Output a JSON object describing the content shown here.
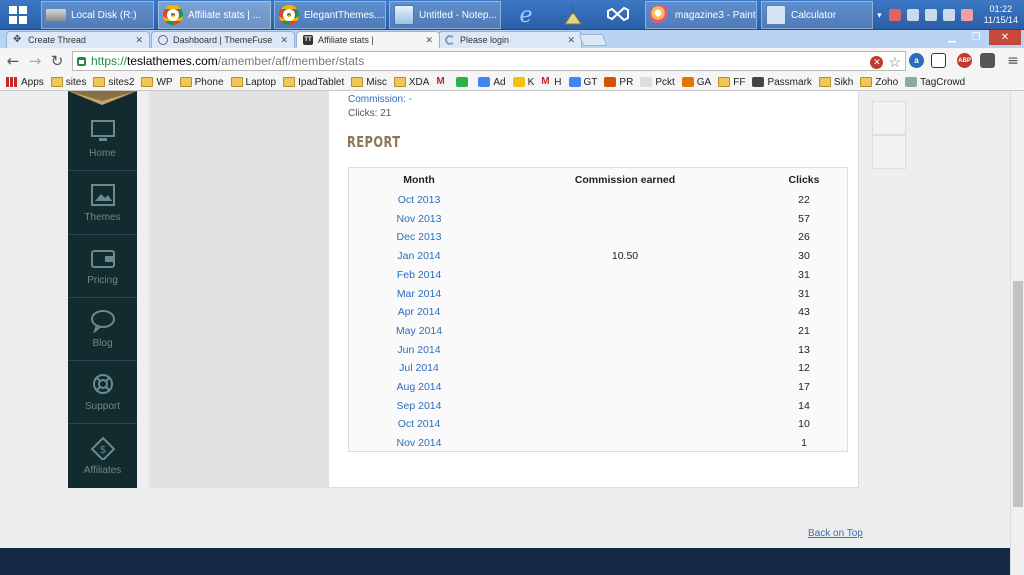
{
  "taskbar": {
    "items": [
      {
        "label": "Local Disk (R:)"
      },
      {
        "label": "Affiliate stats | ..."
      },
      {
        "label": "ElegantThemes...."
      },
      {
        "label": "Untitled - Notep..."
      },
      {
        "label": "magazine3 - Paint"
      },
      {
        "label": "Calculator"
      }
    ],
    "clock_time": "01:22",
    "clock_date": "11/15/14"
  },
  "browser": {
    "tabs": [
      {
        "label": "Create Thread"
      },
      {
        "label": "Dashboard | ThemeFuse"
      },
      {
        "label": "Affiliate stats |",
        "active": true
      },
      {
        "label": "Please login"
      }
    ],
    "url_scheme": "https://",
    "url_host": "teslathemes.com",
    "url_path": "/amember/aff/member/stats",
    "bookmarks": [
      {
        "label": "Apps",
        "icon": "apps-grid-icon"
      },
      {
        "label": "sites",
        "icon": "folder-icon"
      },
      {
        "label": "sites2",
        "icon": "folder-icon"
      },
      {
        "label": "WP",
        "icon": "folder-icon"
      },
      {
        "label": "Phone",
        "icon": "folder-icon"
      },
      {
        "label": "Laptop",
        "icon": "folder-icon"
      },
      {
        "label": "IpadTablet",
        "icon": "folder-icon"
      },
      {
        "label": "Misc",
        "icon": "folder-icon"
      },
      {
        "label": "XDA",
        "icon": "folder-icon"
      },
      {
        "label": "",
        "icon": "gmail-icon"
      },
      {
        "label": "",
        "icon": "feedly-icon"
      },
      {
        "label": "Ad",
        "icon": "google-icon"
      },
      {
        "label": "K",
        "icon": "k-icon"
      },
      {
        "label": "H",
        "icon": "gmail-icon"
      },
      {
        "label": "GT",
        "icon": "translate-icon"
      },
      {
        "label": "PR",
        "icon": "pr-icon"
      },
      {
        "label": "Pckt",
        "icon": "page-icon"
      },
      {
        "label": "GA",
        "icon": "analytics-icon"
      },
      {
        "label": "FF",
        "icon": "folder-icon"
      },
      {
        "label": "Passmark",
        "icon": "passmark-icon"
      },
      {
        "label": "Sikh",
        "icon": "folder-icon"
      },
      {
        "label": "Zoho",
        "icon": "folder-open-icon"
      },
      {
        "label": "TagCrowd",
        "icon": "tagcrowd-icon"
      }
    ]
  },
  "sidebar": {
    "items": [
      {
        "label": "Home",
        "icon": "monitor-icon"
      },
      {
        "label": "Themes",
        "icon": "image-icon"
      },
      {
        "label": "Pricing",
        "icon": "wallet-icon"
      },
      {
        "label": "Blog",
        "icon": "speech-bubble-icon"
      },
      {
        "label": "Support",
        "icon": "lifebuoy-icon"
      },
      {
        "label": "Affiliates",
        "icon": "dollar-tag-icon"
      }
    ]
  },
  "content": {
    "commission_line": "Commission: -",
    "clicks_line": "Clicks: 21",
    "report_title": "REPORT",
    "table": {
      "headers": [
        "Month",
        "Commission earned",
        "Clicks"
      ],
      "rows": [
        {
          "month": "Oct 2013",
          "commission": "",
          "clicks": "22"
        },
        {
          "month": "Nov 2013",
          "commission": "",
          "clicks": "57"
        },
        {
          "month": "Dec 2013",
          "commission": "",
          "clicks": "26"
        },
        {
          "month": "Jan 2014",
          "commission": "10.50",
          "clicks": "30"
        },
        {
          "month": "Feb 2014",
          "commission": "",
          "clicks": "31"
        },
        {
          "month": "Mar 2014",
          "commission": "",
          "clicks": "31"
        },
        {
          "month": "Apr 2014",
          "commission": "",
          "clicks": "43"
        },
        {
          "month": "May 2014",
          "commission": "",
          "clicks": "21"
        },
        {
          "month": "Jun 2014",
          "commission": "",
          "clicks": "13"
        },
        {
          "month": "Jul 2014",
          "commission": "",
          "clicks": "12"
        },
        {
          "month": "Aug 2014",
          "commission": "",
          "clicks": "17"
        },
        {
          "month": "Sep 2014",
          "commission": "",
          "clicks": "14"
        },
        {
          "month": "Oct 2014",
          "commission": "",
          "clicks": "10"
        },
        {
          "month": "Nov 2014",
          "commission": "",
          "clicks": "1"
        }
      ]
    },
    "back_on_top": "Back on Top"
  },
  "colors": {
    "sidebar_bg": "#112b2e",
    "link_blue": "#2a6ebb",
    "report_title": "#8e7658",
    "footer_bg": "#152844"
  }
}
